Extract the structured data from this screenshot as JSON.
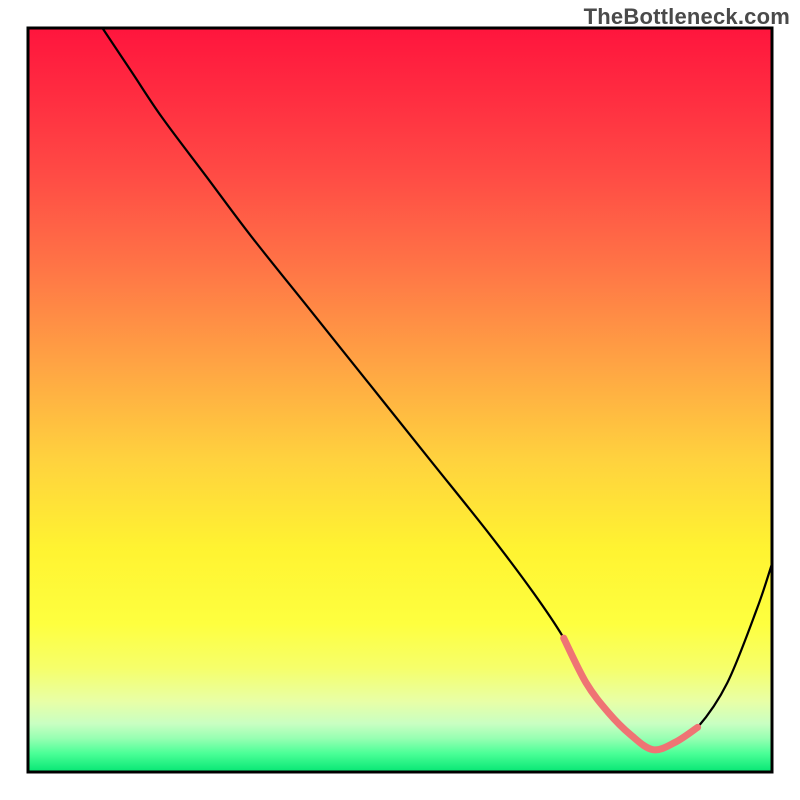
{
  "watermark": "TheBottleneck.com",
  "chart_data": {
    "type": "line",
    "title": "",
    "xlabel": "",
    "ylabel": "",
    "xlim": [
      0,
      100
    ],
    "ylim": [
      0,
      100
    ],
    "grid": false,
    "axes_visible": false,
    "background_gradient_stops": [
      {
        "pos": 0.0,
        "color": "#ff153d"
      },
      {
        "pos": 0.1,
        "color": "#ff2f41"
      },
      {
        "pos": 0.2,
        "color": "#ff4c45"
      },
      {
        "pos": 0.32,
        "color": "#ff7446"
      },
      {
        "pos": 0.45,
        "color": "#ffa344"
      },
      {
        "pos": 0.58,
        "color": "#ffd23e"
      },
      {
        "pos": 0.7,
        "color": "#fff331"
      },
      {
        "pos": 0.8,
        "color": "#feff3f"
      },
      {
        "pos": 0.86,
        "color": "#f6ff6a"
      },
      {
        "pos": 0.905,
        "color": "#e8ffa6"
      },
      {
        "pos": 0.935,
        "color": "#c9ffc2"
      },
      {
        "pos": 0.955,
        "color": "#96ffb2"
      },
      {
        "pos": 0.975,
        "color": "#4bff97"
      },
      {
        "pos": 1.0,
        "color": "#06e673"
      }
    ],
    "series": [
      {
        "name": "bottleneck-curve",
        "stroke": "#000000",
        "stroke_width": 2.2,
        "smooth": true,
        "x": [
          10,
          14,
          18,
          24,
          30,
          38,
          46,
          54,
          62,
          68,
          72,
          75,
          78,
          81,
          84,
          87,
          90,
          94,
          98,
          100
        ],
        "values": [
          100,
          94,
          88,
          80,
          72,
          62,
          52,
          42,
          32,
          24,
          18,
          12,
          8,
          5,
          3,
          4,
          6,
          12,
          22,
          28
        ]
      },
      {
        "name": "optimal-segment",
        "stroke": "#ef7474",
        "stroke_width": 7,
        "smooth": true,
        "x": [
          72,
          75,
          78,
          81,
          84,
          87,
          90
        ],
        "values": [
          18,
          12,
          8,
          5,
          3,
          4,
          6
        ]
      }
    ],
    "annotations": []
  }
}
